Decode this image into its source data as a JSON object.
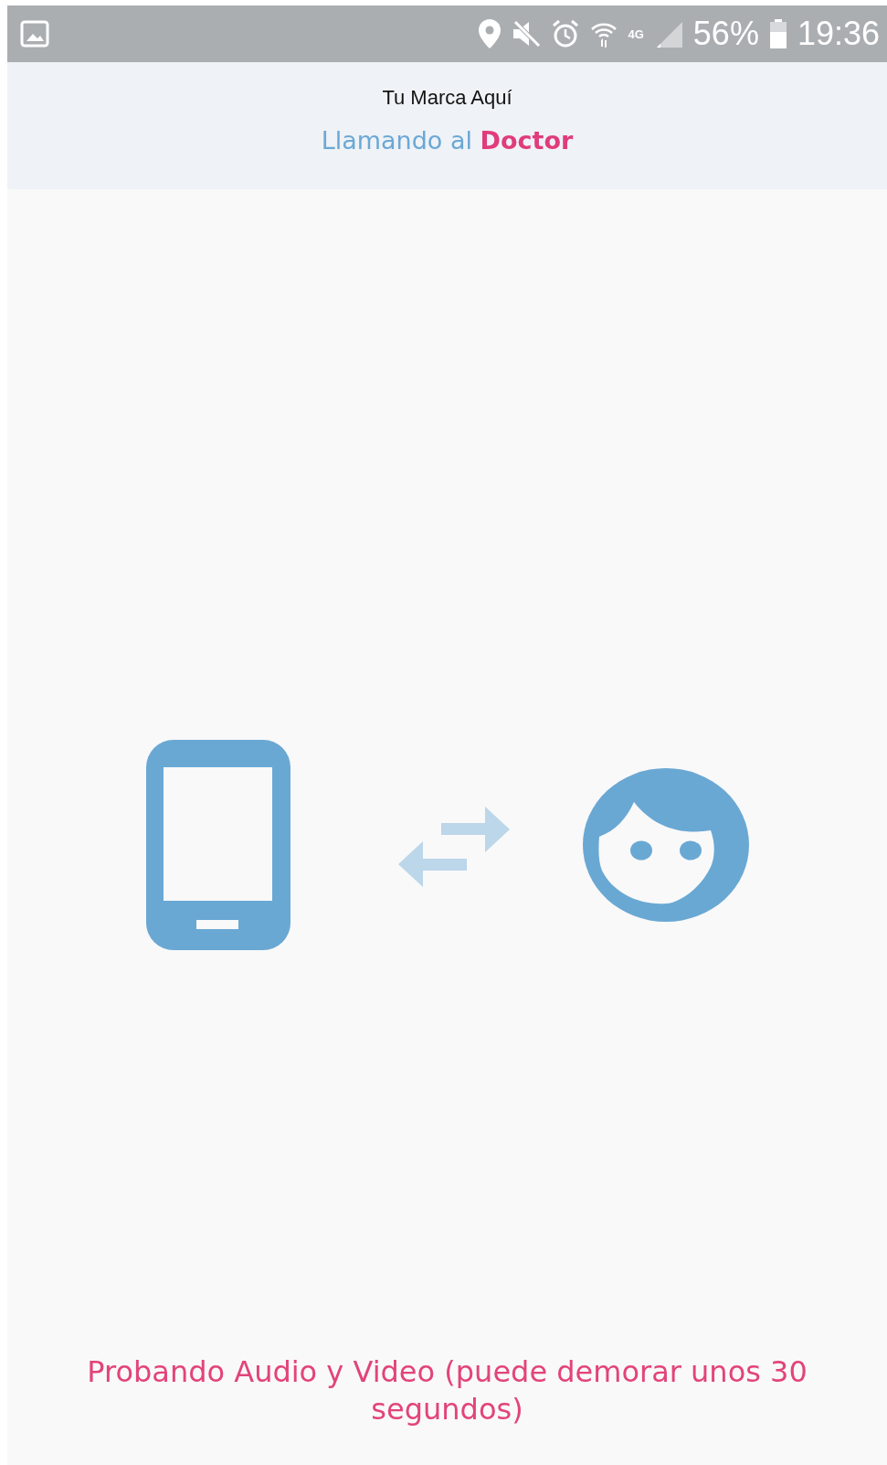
{
  "status_bar": {
    "network": "4G",
    "battery": "56%",
    "time": "19:36"
  },
  "header": {
    "brand": "Tu Marca Aquí",
    "subtitle": "Llamando al **Doctor**"
  },
  "message": "Probando Audio y Video (puede demorar unos 30 segundos)"
}
